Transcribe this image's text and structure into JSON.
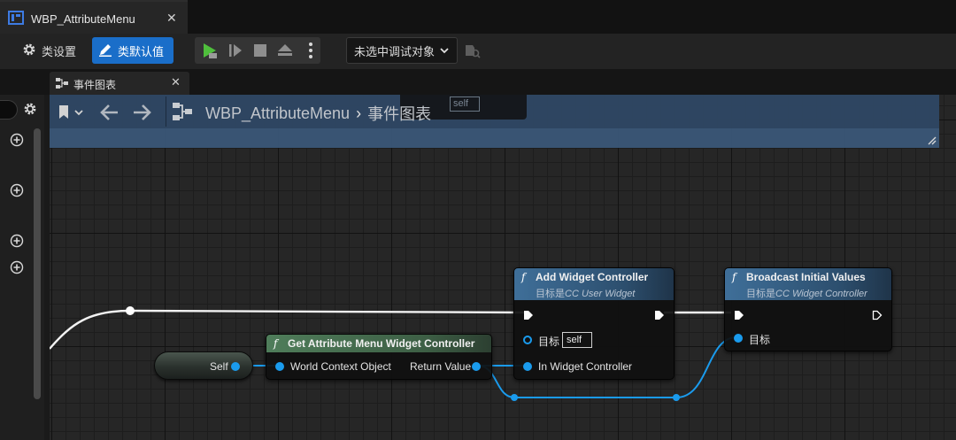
{
  "window": {
    "tab_title": "WBP_AttributeMenu",
    "close_glyph": "✕"
  },
  "toolbar": {
    "class_settings_label": "类设置",
    "class_defaults_label": "类默认值",
    "debug_object_label": "未选中调试对象"
  },
  "graph_tab": {
    "title": "事件图表",
    "close_glyph": "✕"
  },
  "graph_header": {
    "breadcrumb_asset": "WBP_AttributeMenu",
    "breadcrumb_separator": "›",
    "breadcrumb_graph": "事件图表",
    "ghost_self": "self"
  },
  "nodes": {
    "self_node": {
      "label": "Self"
    },
    "get_controller": {
      "title": "Get Attribute Menu Widget Controller",
      "in_pin": "World Context Object",
      "out_pin": "Return Value"
    },
    "add_widget_controller": {
      "title": "Add Widget Controller",
      "subtitle_prefix": "目标是",
      "subtitle_class": "CC User Widget",
      "target_label": "目标",
      "target_value": "self",
      "in_pin": "In Widget Controller"
    },
    "broadcast": {
      "title": "Broadcast Initial Values",
      "subtitle_prefix": "目标是",
      "subtitle_class": "CC Widget Controller",
      "target_label": "目标"
    }
  },
  "colors": {
    "accent_blue": "#1a6ec9",
    "object_pin": "#1a9bed",
    "exec_wire": "#ffffff",
    "pure_node_header": "#53815f",
    "function_node_header": "#3e6c95"
  },
  "icons": [
    "blueprint-tab-icon",
    "gear-icon",
    "pencil-icon",
    "play-icon",
    "step-icon",
    "stop-icon",
    "eject-icon",
    "more-icon",
    "chevron-down-icon",
    "debug-find-icon",
    "graph-icon",
    "bookmark-icon",
    "back-arrow-icon",
    "forward-arrow-icon",
    "add-icon",
    "function-icon",
    "resize-grip-icon"
  ]
}
